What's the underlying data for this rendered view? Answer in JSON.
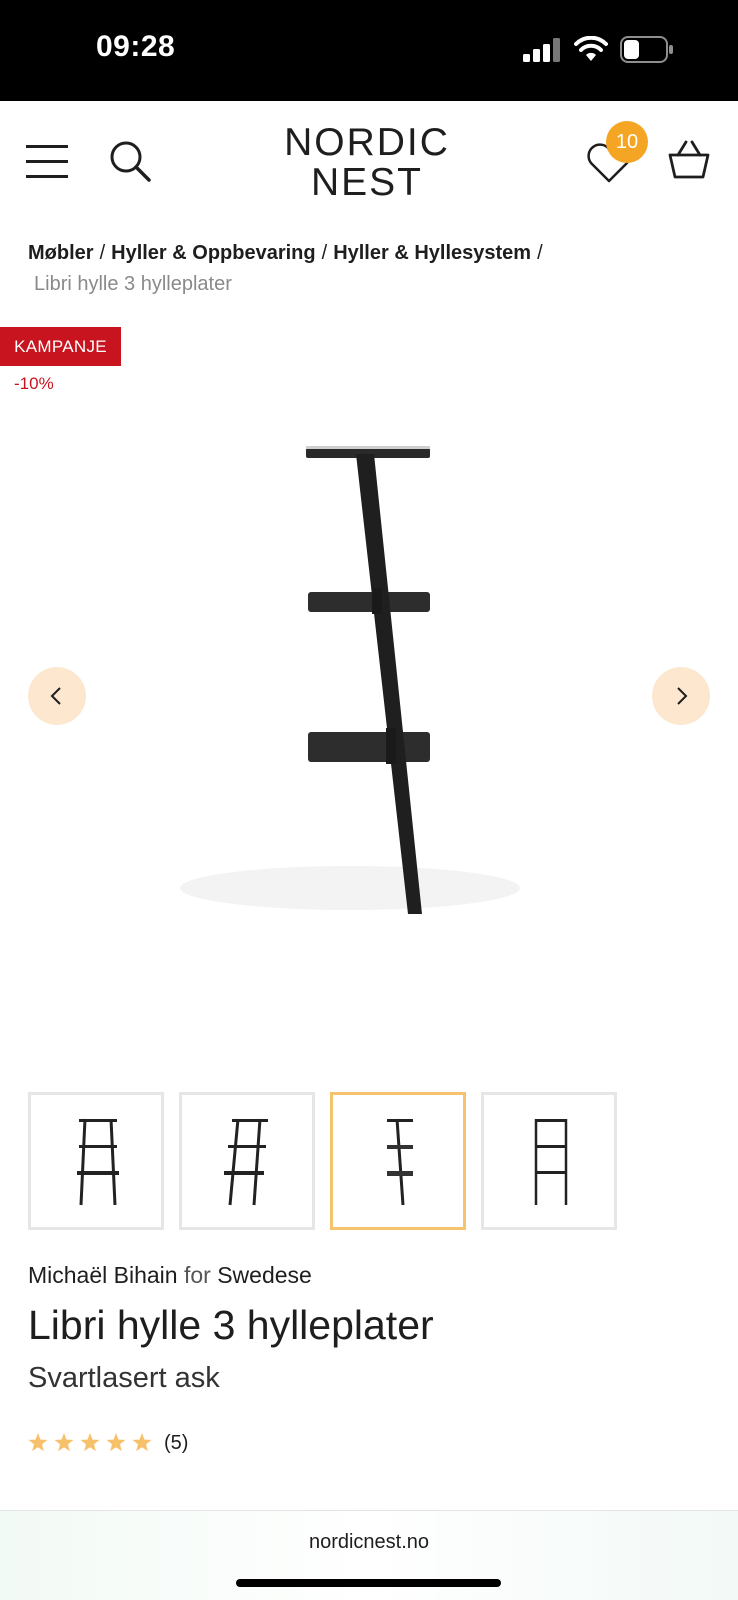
{
  "status": {
    "time": "09:28"
  },
  "header": {
    "logo_line1": "NORDIC",
    "logo_line2": "NEST",
    "wishlist_count": "10"
  },
  "breadcrumb": {
    "items": [
      "Møbler",
      "Hyller & Oppbevaring",
      "Hyller & Hyllesystem"
    ],
    "separator": "/",
    "current": "Libri hylle 3 hylleplater"
  },
  "badges": {
    "promo": "KAMPANJE",
    "discount": "-10%"
  },
  "product": {
    "designer": "Michaël Bihain",
    "for": "for",
    "brand": "Swedese",
    "title": "Libri hylle 3 hylleplater",
    "variant": "Svartlasert ask",
    "rating_stars": 5,
    "rating_count": "(5)"
  },
  "gallery": {
    "thumbnail_count": 4,
    "active_index": 2
  },
  "browser": {
    "url": "nordicnest.no"
  },
  "colors": {
    "promo_red": "#c8141e",
    "accent_orange": "#f5a524",
    "arrow_bg": "#fde8cf",
    "active_thumb_border": "#f5c36e",
    "star": "#f7c06a"
  }
}
